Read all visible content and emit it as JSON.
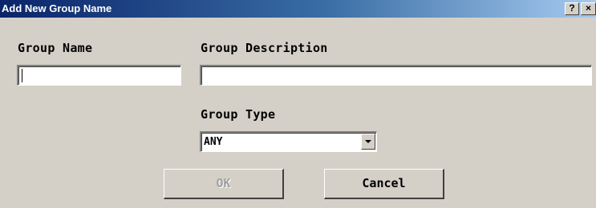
{
  "window": {
    "title": "Add New Group Name",
    "help_glyph": "?",
    "close_glyph": "×"
  },
  "form": {
    "group_name": {
      "label": "Group Name",
      "value": ""
    },
    "group_description": {
      "label": "Group Description",
      "value": ""
    },
    "group_type": {
      "label": "Group Type",
      "selected": "ANY"
    }
  },
  "buttons": {
    "ok_label": "OK",
    "ok_enabled": false,
    "cancel_label": "Cancel"
  },
  "colors": {
    "window_bg": "#d4d0c8",
    "title_gradient_start": "#0a246a",
    "title_gradient_end": "#a6caf0",
    "disabled_text": "#a0a0a0"
  }
}
